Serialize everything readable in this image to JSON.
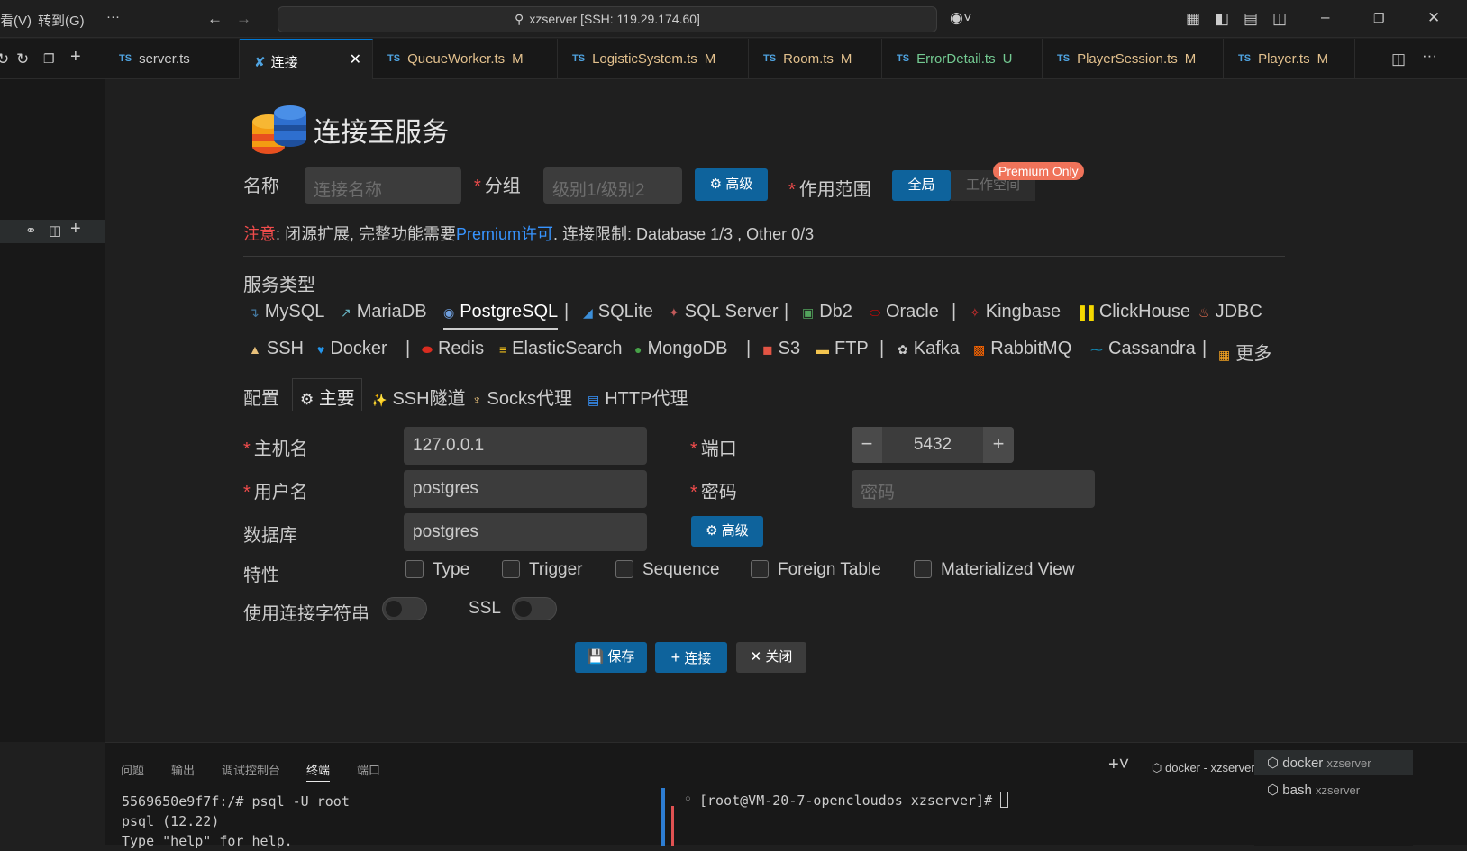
{
  "titlebar": {
    "menu_view": "看(V)",
    "menu_goto": "转到(G)",
    "menu_more": "···",
    "search_text": "xzserver [SSH: 119.29.174.60]"
  },
  "tabs": [
    {
      "label": "server.ts",
      "badge": "",
      "prefix": "TS"
    },
    {
      "label": "连接",
      "badge": "",
      "prefix": ""
    },
    {
      "label": "QueueWorker.ts",
      "badge": "M",
      "prefix": "TS"
    },
    {
      "label": "LogisticSystem.ts",
      "badge": "M",
      "prefix": "TS"
    },
    {
      "label": "Room.ts",
      "badge": "M",
      "prefix": "TS"
    },
    {
      "label": "ErrorDetail.ts",
      "badge": "U",
      "prefix": "TS"
    },
    {
      "label": "PlayerSession.ts",
      "badge": "M",
      "prefix": "TS"
    },
    {
      "label": "Player.ts",
      "badge": "M",
      "prefix": "TS"
    }
  ],
  "form": {
    "title": "连接至服务",
    "name_label": "名称",
    "name_placeholder": "连接名称",
    "group_label": "分组",
    "group_placeholder": "级别1/级别2",
    "advanced_label": "高级",
    "scope_label": "作用范围",
    "scope_global": "全局",
    "scope_workspace": "工作空间",
    "premium_badge": "Premium Only",
    "notice_prefix": "注意",
    "notice_text1": ": 闭源扩展, 完整功能需要",
    "notice_link": "Premium许可",
    "notice_text2": ". 连接限制: Database 1/3 , Other 0/3",
    "service_type_label": "服务类型",
    "services_row1": [
      "MySQL",
      "MariaDB",
      "PostgreSQL",
      "SQLite",
      "SQL Server",
      "Db2",
      "Oracle",
      "Kingbase",
      "ClickHouse",
      "JDBC"
    ],
    "services_row2": [
      "SSH",
      "Docker",
      "Redis",
      "ElasticSearch",
      "MongoDB",
      "S3",
      "FTP",
      "Kafka",
      "RabbitMQ",
      "Cassandra",
      "更多"
    ],
    "config_label": "配置",
    "config_tabs": [
      "主要",
      "SSH隧道",
      "Socks代理",
      "HTTP代理"
    ],
    "host_label": "主机名",
    "host_value": "127.0.0.1",
    "port_label": "端口",
    "port_value": "5432",
    "user_label": "用户名",
    "user_value": "postgres",
    "password_label": "密码",
    "password_placeholder": "密码",
    "database_label": "数据库",
    "database_value": "postgres",
    "db_advanced_label": "高级",
    "features_label": "特性",
    "features": [
      "Type",
      "Trigger",
      "Sequence",
      "Foreign Table",
      "Materialized View"
    ],
    "conn_string_label": "使用连接字符串",
    "ssl_label": "SSL",
    "save_label": "保存",
    "connect_label": "连接",
    "close_label": "关闭"
  },
  "panel": {
    "tabs": [
      "问题",
      "输出",
      "调试控制台",
      "终端",
      "端口"
    ],
    "active_tab": "终端",
    "terminal_title": "docker - xzserver",
    "terminal_left": [
      "5569650e9f7f:/# psql -U root",
      "psql (12.22)",
      "Type \"help\" for help."
    ],
    "terminal_right": "[root@VM-20-7-opencloudos xzserver]# ",
    "terminals": [
      {
        "name": "docker",
        "host": "xzserver"
      },
      {
        "name": "bash",
        "host": "xzserver"
      }
    ]
  },
  "colors": {
    "accent": "#0e639c",
    "warning": "#f14c4c",
    "premium": "#f0735a",
    "modified": "#e2c08d",
    "untracked": "#73c991"
  }
}
